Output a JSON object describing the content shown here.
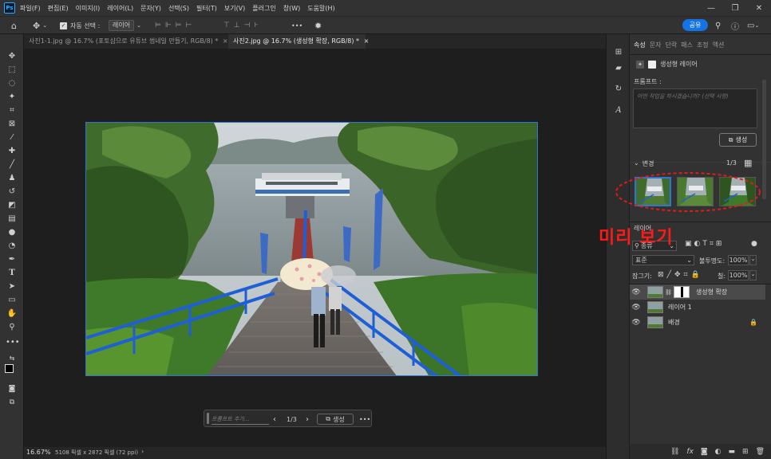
{
  "menubar": {
    "logo": "Ps",
    "items": [
      "파일(F)",
      "편집(E)",
      "이미지(I)",
      "레이어(L)",
      "문자(Y)",
      "선택(S)",
      "필터(T)",
      "보기(V)",
      "플러그인",
      "창(W)",
      "도움말(H)"
    ]
  },
  "options": {
    "auto_select_label": "자동 선택 :",
    "auto_select_value": "레이어",
    "more": "•••",
    "share": "공유"
  },
  "tabs": [
    {
      "label": "사진1-1.jpg @ 16.7% (포토샵으로 유튜브 썸네일 만들기, RGB/8) *",
      "close": "×"
    },
    {
      "label": "사진2.jpg @ 16.7% (생성형 확장, RGB/8) *",
      "close": "×"
    }
  ],
  "floatbar": {
    "placeholder": "프롬프트 추가...",
    "page": "1/3",
    "generate": "생성",
    "more": "•••"
  },
  "status": {
    "zoom": "16.67%",
    "info": "5108 픽셀 x 2872 픽셀 (72 ppi)",
    "arrow": "›"
  },
  "panel": {
    "tabs": [
      "속성",
      "문자",
      "단락",
      "패스",
      "조정",
      "액션"
    ],
    "layer_type": "생성형 레이어",
    "prompt_label": "프롬프트 :",
    "prompt_placeholder": "어떤 작업을 하시겠습니까? (선택 사항)",
    "generate": "생성",
    "variations_label": "변경",
    "variations_count": "1/3"
  },
  "annotation": "미리 보기",
  "layers": {
    "title": "레이어",
    "filter": "종류",
    "blend_mode": "표준",
    "opacity_label": "불투명도:",
    "opacity_value": "100%",
    "lock_label": "잠그기:",
    "fill_label": "칠:",
    "fill_value": "100%",
    "items": [
      {
        "name": "생성형 확장"
      },
      {
        "name": "레이어 1"
      },
      {
        "name": "배경"
      }
    ]
  }
}
